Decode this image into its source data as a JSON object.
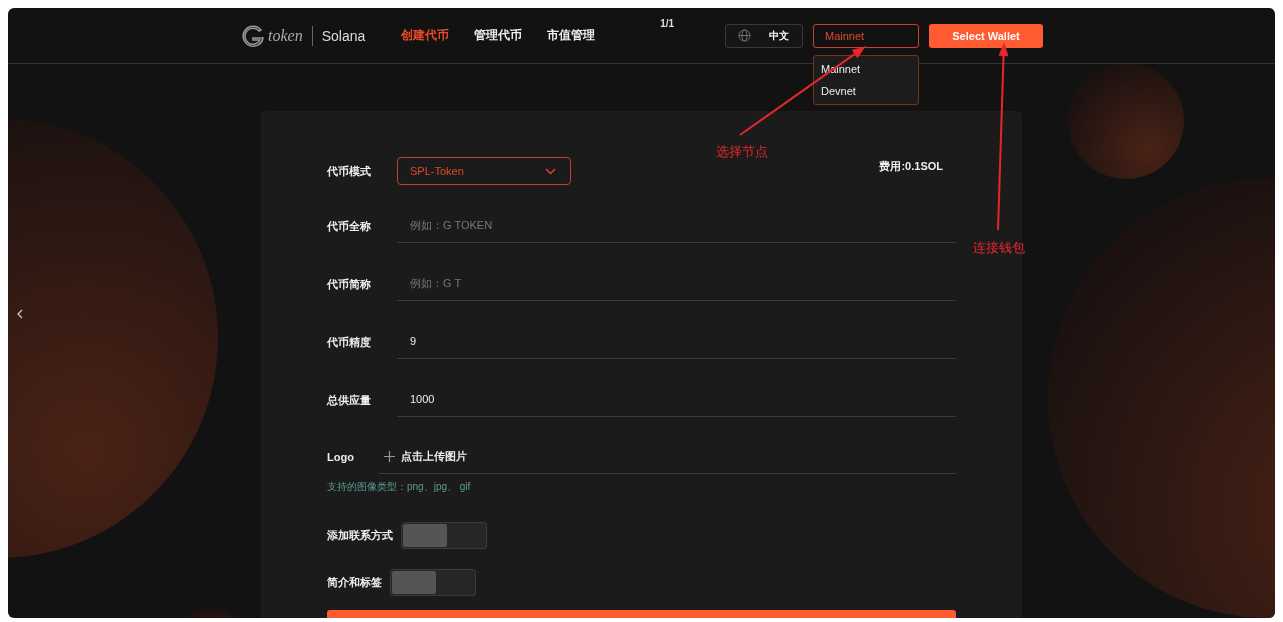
{
  "header": {
    "logo_text": "token",
    "chain": "Solana",
    "nav": [
      {
        "label": "创建代币",
        "selected": true
      },
      {
        "label": "管理代币",
        "selected": false
      },
      {
        "label": "市值管理",
        "selected": false
      }
    ],
    "page_indicator": "1/1",
    "language": "中文",
    "network": {
      "value": "Mainnet",
      "options": [
        "Mainnet",
        "Devnet"
      ]
    },
    "wallet_button": "Select Wallet"
  },
  "form": {
    "fee": "费用:0.1SOL",
    "fields": [
      {
        "kind": "select",
        "label": "代币模式",
        "value": "SPL-Token"
      },
      {
        "kind": "text",
        "label": "代币全称",
        "placeholder": "例如：G TOKEN"
      },
      {
        "kind": "text",
        "label": "代币简称",
        "placeholder": "例如：G T"
      },
      {
        "kind": "text",
        "label": "代币精度",
        "value": "9"
      },
      {
        "kind": "text",
        "label": "总供应量",
        "value": "1000"
      },
      {
        "kind": "upload",
        "label": "Logo",
        "value": "点击上传图片"
      }
    ],
    "hint": "支持的图像类型：png、jpg、 gif",
    "toggles": [
      {
        "label": "添加联系方式",
        "on": false
      },
      {
        "label": "简介和标签",
        "on": false
      }
    ]
  },
  "annotations": [
    {
      "text": "选择节点"
    },
    {
      "text": "连接钱包"
    }
  ]
}
